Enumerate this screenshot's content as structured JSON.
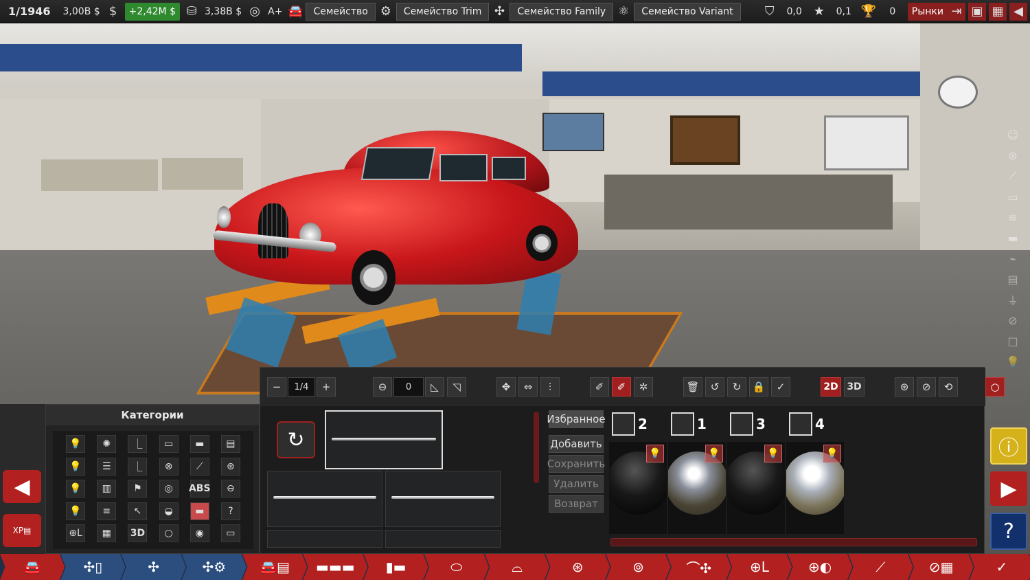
{
  "topbar": {
    "year": "1/1946",
    "money": "3,00B $",
    "income": "+2,42M $",
    "value": "3,38B $",
    "rating": "A+",
    "family": "Семейство",
    "trim_family": "Семейство Trim",
    "family_family": "Семейство Family",
    "variant_family": "Семейство Variant",
    "score1": "0,0",
    "score2": "0,1",
    "trophies": "0",
    "markets": "Рынки"
  },
  "categories": {
    "title": "Категории",
    "items": [
      {
        "icon": "bulb-icon",
        "label": "💡"
      },
      {
        "icon": "gear-icon",
        "label": "✺"
      },
      {
        "icon": "seat-icon",
        "label": "⎿"
      },
      {
        "icon": "car-front-icon",
        "label": "▭"
      },
      {
        "icon": "truck-icon",
        "label": "▬"
      },
      {
        "icon": "panel-icon",
        "label": "▤"
      },
      {
        "icon": "bulb-icon",
        "label": "💡"
      },
      {
        "icon": "list-icon",
        "label": "☰"
      },
      {
        "icon": "seat-icon",
        "label": "⎿"
      },
      {
        "icon": "wheel-icon",
        "label": "⊗"
      },
      {
        "icon": "pen-icon",
        "label": "⟋"
      },
      {
        "icon": "wheel-icon",
        "label": "⊛"
      },
      {
        "icon": "bulb-icon",
        "label": "💡"
      },
      {
        "icon": "book-icon",
        "label": "▥"
      },
      {
        "icon": "flag-icon",
        "label": "⚑"
      },
      {
        "icon": "ring-icon",
        "label": "◎"
      },
      {
        "icon": "abs-icon",
        "label": "ABS"
      },
      {
        "icon": "link-icon",
        "label": "⊖"
      },
      {
        "icon": "bulb-icon",
        "label": "💡"
      },
      {
        "icon": "stripe-icon",
        "label": "≡"
      },
      {
        "icon": "cursor-icon",
        "label": "↖"
      },
      {
        "icon": "mirror-icon",
        "label": "◒"
      },
      {
        "icon": "bumper-icon",
        "label": "▬"
      },
      {
        "icon": "help-icon",
        "label": "?"
      },
      {
        "icon": "light-l-icon",
        "label": "⊕L"
      },
      {
        "icon": "grid-icon",
        "label": "▦"
      },
      {
        "icon": "text-3d-icon",
        "label": "3D"
      },
      {
        "icon": "circle-icon",
        "label": "○"
      },
      {
        "icon": "target-icon",
        "label": "◉"
      },
      {
        "icon": "plate-icon",
        "label": "▭"
      }
    ]
  },
  "toolbar": {
    "page": "1/4",
    "rotation": "0",
    "mode_2d": "2D",
    "mode_3d": "3D"
  },
  "actions": {
    "favorites": "Избранное",
    "add": "Добавить",
    "save": "Сохранить",
    "delete": "Удалить",
    "return": "Возврат"
  },
  "materials": [
    {
      "num": "2"
    },
    {
      "num": "1"
    },
    {
      "num": "3"
    },
    {
      "num": "4"
    }
  ],
  "colors": {
    "accent_red": "#b32020",
    "nav_blue": "#1f2f46",
    "warn_yellow": "#d6b21a",
    "help_blue": "#12306b"
  }
}
